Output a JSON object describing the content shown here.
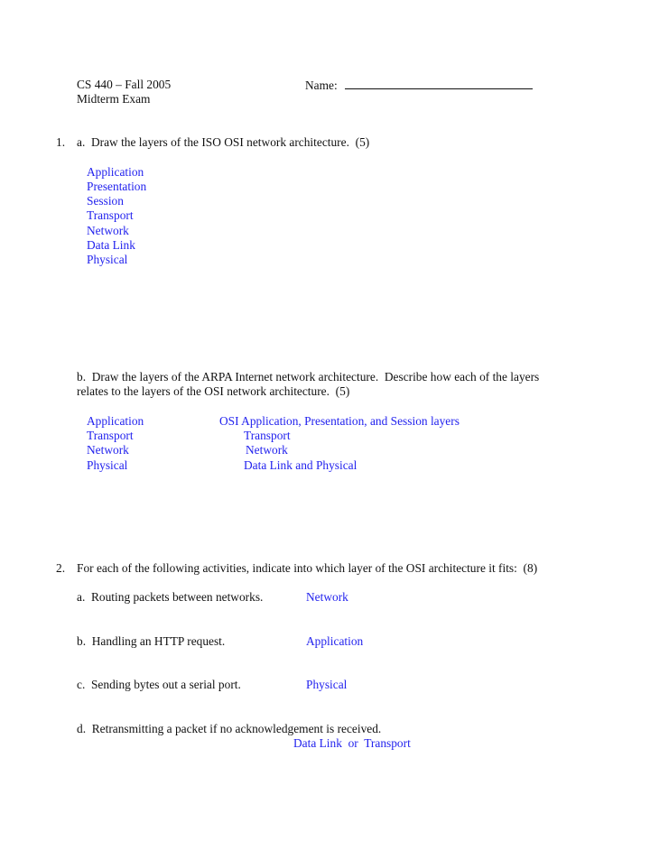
{
  "header": {
    "course": "CS 440 – Fall 2005",
    "exam": "Midterm Exam",
    "name_label": "Name:"
  },
  "q1": {
    "number": "1.",
    "a": {
      "prompt": "a.  Draw the layers of the ISO OSI network architecture.  (5)",
      "answers": [
        "Application",
        "Presentation",
        "Session",
        "Transport",
        "Network",
        "Data Link",
        "Physical"
      ]
    },
    "b": {
      "prompt_line1": "b.  Draw the layers of the ARPA Internet network architecture.  Describe how each of the layers",
      "prompt_line2": "relates to the layers of the OSI network architecture.  (5)",
      "rows": [
        {
          "layer": "Application",
          "osi": "OSI Application, Presentation, and Session layers"
        },
        {
          "layer": "Transport",
          "osi": "Transport"
        },
        {
          "layer": "Network",
          "osi": "Network"
        },
        {
          "layer": "Physical",
          "osi": "Data Link and Physical"
        }
      ]
    }
  },
  "q2": {
    "number": "2.",
    "prompt": "For each of the following activities, indicate into which layer of the OSI architecture it fits:  (8)",
    "items": [
      {
        "text": "a.  Routing packets between networks.",
        "answer": "Network"
      },
      {
        "text": "b.  Handling an HTTP request.",
        "answer": "Application"
      },
      {
        "text": "c.  Sending bytes out a serial port.",
        "answer": "Physical"
      },
      {
        "text": "d.  Retransmitting a packet if no acknowledgement is received.",
        "answer": "Data Link  or  Transport"
      }
    ]
  }
}
